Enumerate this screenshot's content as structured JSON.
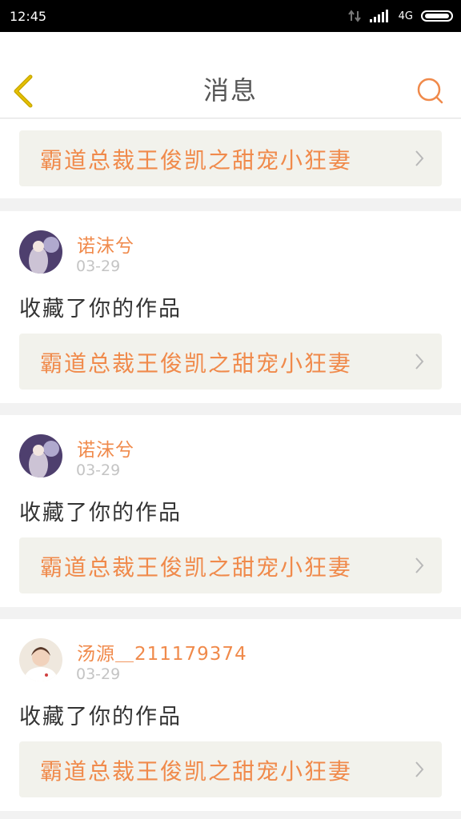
{
  "status_bar": {
    "time": "12:45",
    "network": "4G"
  },
  "header": {
    "title": "消息"
  },
  "top_card": {
    "work_title": "霸道总裁王俊凯之甜宠小狂妻"
  },
  "notifications": [
    {
      "user": "诺沫兮",
      "date": "03-29",
      "message": "收藏了你的作品",
      "work_title": "霸道总裁王俊凯之甜宠小狂妻",
      "avatar_color": "#6a5a8a"
    },
    {
      "user": "诺沫兮",
      "date": "03-29",
      "message": "收藏了你的作品",
      "work_title": "霸道总裁王俊凯之甜宠小狂妻",
      "avatar_color": "#6a5a8a"
    },
    {
      "user": "汤源＿211179374",
      "date": "03-29",
      "message": "收藏了你的作品",
      "work_title": "霸道总裁王俊凯之甜宠小狂妻",
      "avatar_color": "#e8ddd0"
    }
  ],
  "colors": {
    "accent": "#f08a4b",
    "card_bg": "#f2f2ec",
    "page_bg": "#f2f2f2"
  }
}
